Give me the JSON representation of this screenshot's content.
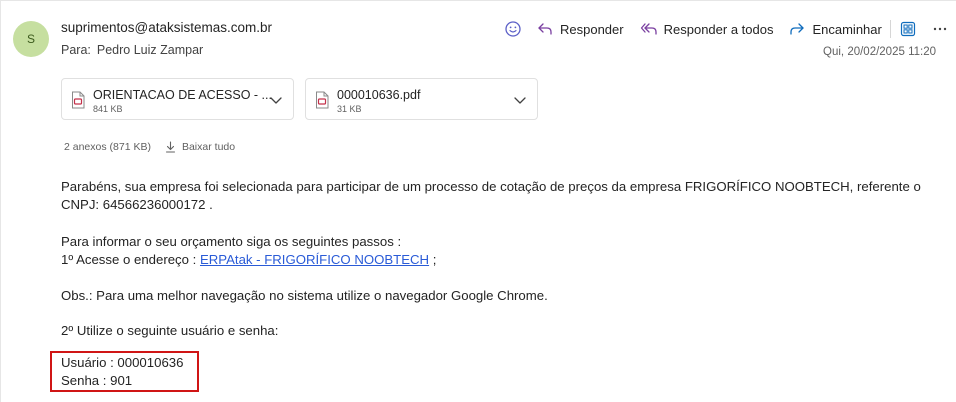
{
  "header": {
    "avatar_letter": "S",
    "sender": "suprimentos@ataksistemas.com.br",
    "to_label": "Para:",
    "to_name": "Pedro Luiz Zampar",
    "date": "Qui, 20/02/2025 11:20"
  },
  "actions": {
    "reply": "Responder",
    "reply_all": "Responder a todos",
    "forward": "Encaminhar"
  },
  "attachments": [
    {
      "name": "ORIENTACAO DE ACESSO - ...",
      "size": "841 KB"
    },
    {
      "name": "000010636.pdf",
      "size": "31 KB"
    }
  ],
  "attachments_summary": {
    "count": "2 anexos (871 KB)",
    "download_all": "Baixar tudo"
  },
  "message": {
    "p1_line1": "Parabéns, sua empresa foi selecionada para participar de um processo de cotação de preços da empresa FRIGORÍFICO NOOBTECH, referente o",
    "p1_line2": "CNPJ: 64566236000172 .",
    "p2_line1": "Para informar o seu orçamento siga os seguintes passos :",
    "p2_line2_prefix": "1º Acesse o endereço : ",
    "p2_link": "ERPAtak - FRIGORÍFICO NOOBTECH",
    "p2_line2_suffix": " ;",
    "p3": "Obs.: Para uma melhor navegação no sistema utilize o navegador Google Chrome.",
    "p4": "2º Utilize o seguinte usuário e senha:",
    "user_line": "Usuário : 000010636",
    "password_line": "Senha : 901"
  },
  "colors": {
    "avatar_bg": "#c6dfa0",
    "accent_icon": "#5b5fc7",
    "link": "#2a5bd7",
    "highlight_border": "#d01515",
    "pdf_icon": "#c4314b"
  }
}
